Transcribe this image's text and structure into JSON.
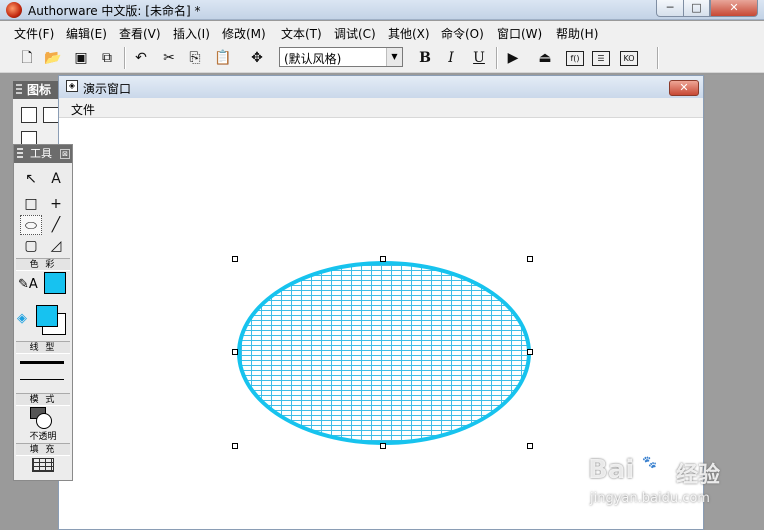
{
  "window": {
    "title": "Authorware 中文版: [未命名] *",
    "min_glyph": "─",
    "max_glyph": "□",
    "close_glyph": "✕"
  },
  "menubar": {
    "items": [
      {
        "label": "文件(F)"
      },
      {
        "label": "编辑(E)"
      },
      {
        "label": "查看(V)"
      },
      {
        "label": "插入(I)"
      },
      {
        "label": "修改(M)"
      },
      {
        "label": "文本(T)"
      },
      {
        "label": "调试(C)"
      },
      {
        "label": "其他(X)"
      },
      {
        "label": "命令(O)"
      },
      {
        "label": "窗口(W)"
      },
      {
        "label": "帮助(H)"
      }
    ]
  },
  "toolbar": {
    "style_value": "(默认风格)",
    "dropdown_glyph": "▼",
    "bold_label": "B",
    "italic_label": "I",
    "underline_label": "U",
    "buttons": [
      "new-icon",
      "open-icon",
      "save-all-icon",
      "import-icon",
      "undo-icon",
      "cut-icon",
      "copy-icon",
      "paste-icon",
      "find-icon",
      "run-icon",
      "control-panel-icon",
      "functions-icon",
      "variables-icon",
      "knowledge-objects-icon"
    ]
  },
  "icon_palette": {
    "title": "图标"
  },
  "presentation": {
    "title": "演示窗口",
    "menu_file": "文件",
    "close_glyph": "✕"
  },
  "toolbox": {
    "title": "工具",
    "close_glyph": "⊠",
    "tools": {
      "pointer": "↖",
      "text": "A",
      "rectangle": "□",
      "cross": "+",
      "oval": "⬭",
      "line": "╱",
      "round_rect": "▢",
      "polygon": "◿"
    },
    "section_color": "色 彩",
    "section_linetype": "线 型",
    "section_mode": "模 式",
    "section_fill": "填 充",
    "mode_text": "不透明",
    "pencil_text": "✎A",
    "bucket_glyph": "◈"
  },
  "colors": {
    "fill_color": "#17c2f0",
    "stroke_color": "#17c3ee",
    "pattern_color": "#40bde6"
  },
  "watermark": {
    "logo": "Bai",
    "paw_glyph": "🐾",
    "jingyan": "经验",
    "domain": "jingyan.baidu.com"
  }
}
